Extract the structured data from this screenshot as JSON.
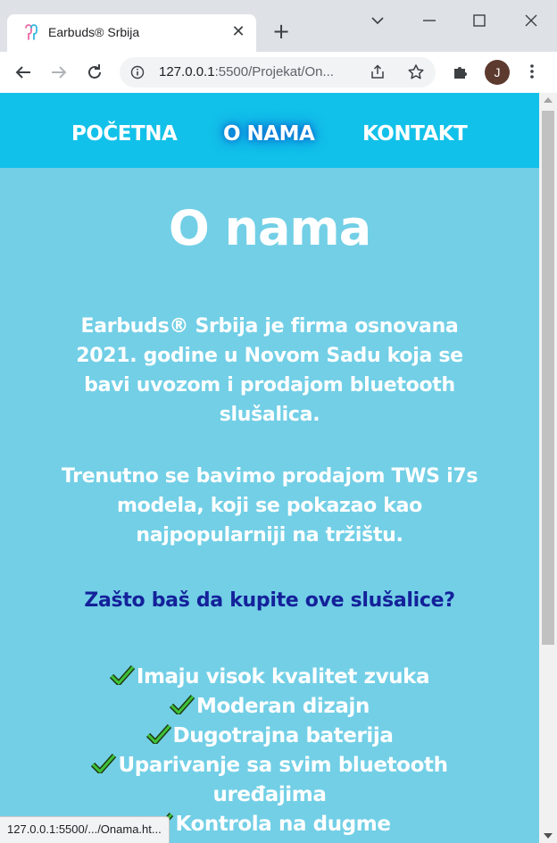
{
  "browser": {
    "tab_title": "Earbuds® Srbija",
    "tab_icon": "earbuds-favicon",
    "url_host": "127.0.0.1",
    "url_rest": ":5500/Projekat/On...",
    "avatar_initial": "J",
    "status_url": "127.0.0.1:5500/.../Onama.ht..."
  },
  "site_nav": {
    "items": [
      {
        "label": "POČETNA"
      },
      {
        "label": "O NAMA",
        "active": true
      },
      {
        "label": "KONTAKT"
      }
    ]
  },
  "page": {
    "title": "O nama",
    "paragraph_1": "Earbuds® Srbija je firma osnovana 2021. godine u Novom Sadu koja se bavi uvozom i prodajom bluetooth slušalica.",
    "paragraph_2": "Trenutno se bavimo prodajom TWS i7s modela, koji se pokazao kao najpopularniji na tržištu.",
    "question": "Zašto baš da kupite ove slušalice?",
    "features": [
      "Imaju visok kvalitet zvuka",
      "Moderan dizajn",
      "Dugotrajna baterija",
      "Uparivanje sa svim bluetooth uređajima",
      "Kontrola na dugme"
    ]
  },
  "colors": {
    "nav_bg": "#12c1e9",
    "page_bg": "#72cfe6",
    "question_text": "#14219a",
    "check_green": "#3fc23a"
  }
}
